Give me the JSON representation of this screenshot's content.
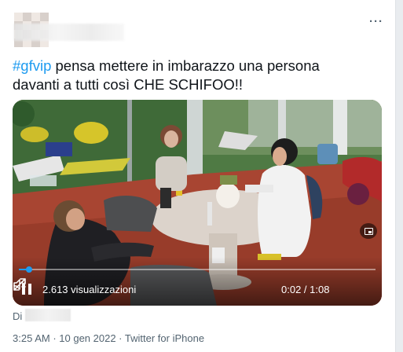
{
  "tweet": {
    "hashtag": "#gfvip",
    "text_line1": " pensa mettere in imbarazzo una persona",
    "text_line2": "davanti a tutti così CHE SCHIFOO!!",
    "more_icon": "more-horizontal-icon"
  },
  "video": {
    "views": "2.613 visualizzazioni",
    "time": "0:02 / 1:08",
    "progress": 0.029,
    "colors": {
      "progress": "#1d9bf0"
    }
  },
  "footer": {
    "via_prefix": "Di",
    "time": "3:25 AM",
    "separator1": " · ",
    "date": "10 gen 2022",
    "separator2": " · ",
    "source": "Twitter for iPhone"
  },
  "colors": {
    "accent": "#1d9bf0",
    "muted": "#536471",
    "text": "#0f1419"
  }
}
